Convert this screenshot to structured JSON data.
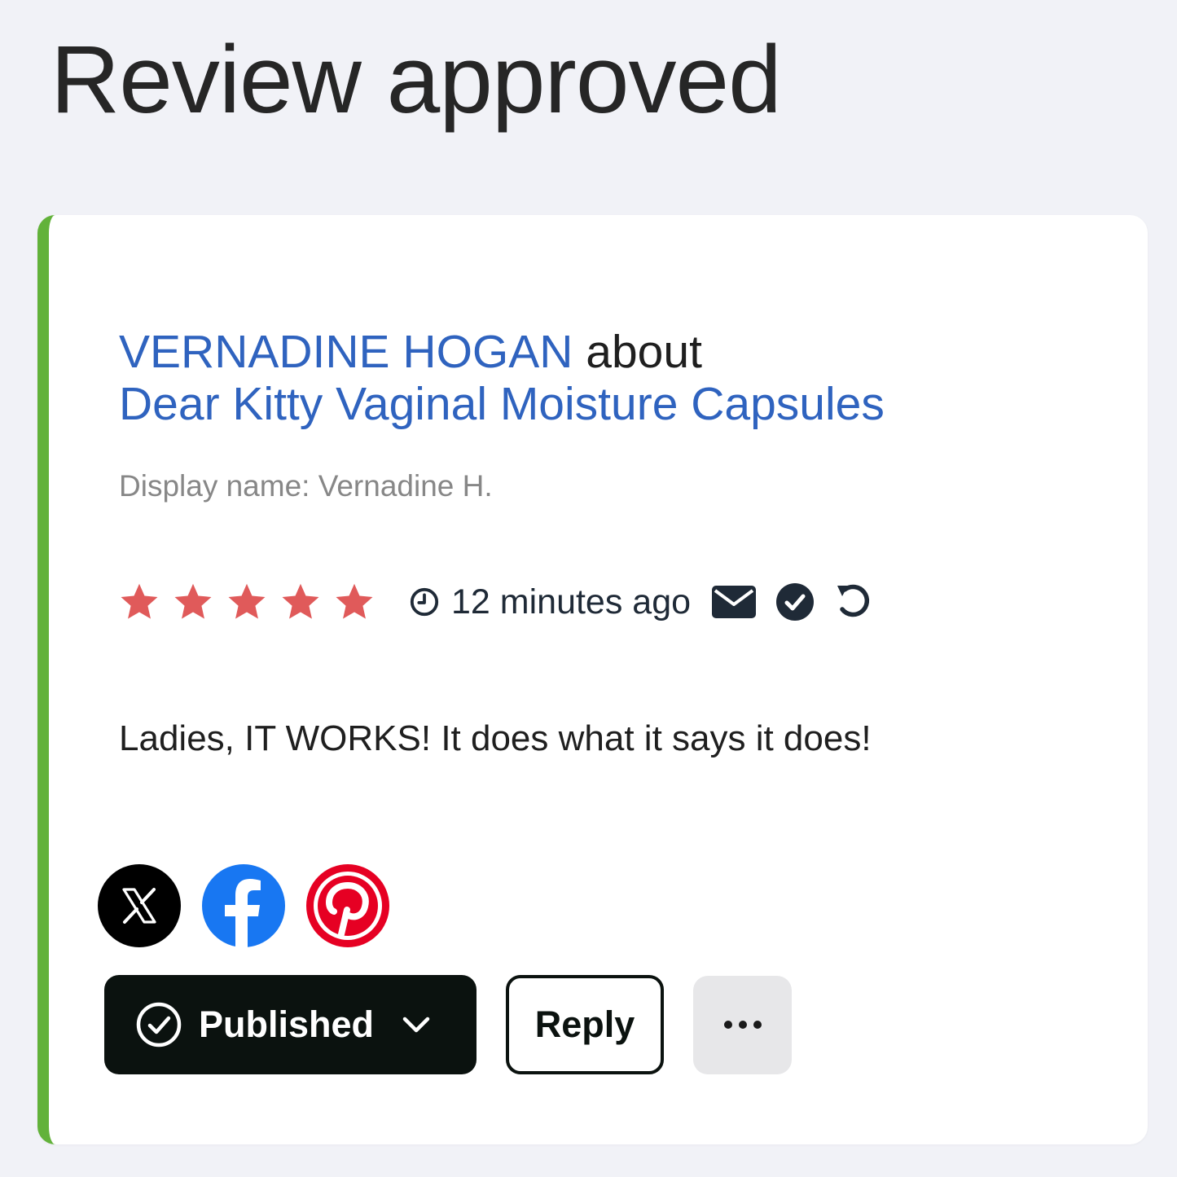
{
  "page": {
    "title": "Review approved"
  },
  "review": {
    "reviewer_name": "VERNADINE HOGAN",
    "about_word": "about",
    "product_name": "Dear Kitty Vaginal Moisture Capsules",
    "display_name": "Display name: Vernadine H.",
    "rating": 5,
    "rating_max": 5,
    "time_ago": "12 minutes ago",
    "body": "Ladies, IT WORKS! It does what it says it does!"
  },
  "social": [
    {
      "name": "x-share-button",
      "icon": "x-icon",
      "color": "#000000"
    },
    {
      "name": "facebook-share-button",
      "icon": "facebook-icon",
      "color": "#1877f2"
    },
    {
      "name": "pinterest-share-button",
      "icon": "pinterest-icon",
      "color": "#e60023"
    }
  ],
  "actions": {
    "status_label": "Published",
    "reply_label": "Reply"
  },
  "colors": {
    "accent_bar": "#62b23a",
    "link": "#2f63bf",
    "star": "#e05a5a",
    "dark": "#0b120f"
  }
}
